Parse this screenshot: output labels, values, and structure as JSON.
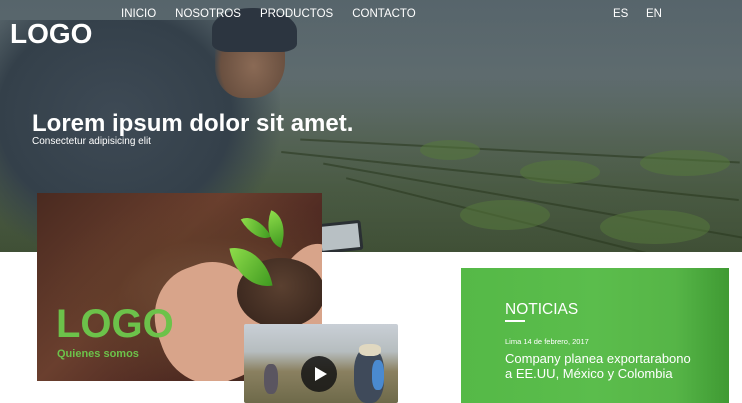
{
  "header": {
    "logo": "LOGO",
    "nav": [
      "INICIO",
      "NOSOTROS",
      "PRODUCTOS",
      "CONTACTO"
    ],
    "languages": [
      "ES",
      "EN"
    ]
  },
  "hero": {
    "title": "Lorem ipsum dolor sit amet.",
    "subtitle": "Consectetur adipisicing elit"
  },
  "about": {
    "logo": "LOGO",
    "link": "Quienes somos"
  },
  "video": {
    "play_icon": "play-icon"
  },
  "news": {
    "title": "NOTICIAS",
    "date": "Lima 14 de febrero, 2017",
    "headline": "Company planea exportarabono a EE.UU, México y Colombia"
  },
  "colors": {
    "accent_green": "#5bbd4c",
    "logo_green": "#6cc24a"
  }
}
